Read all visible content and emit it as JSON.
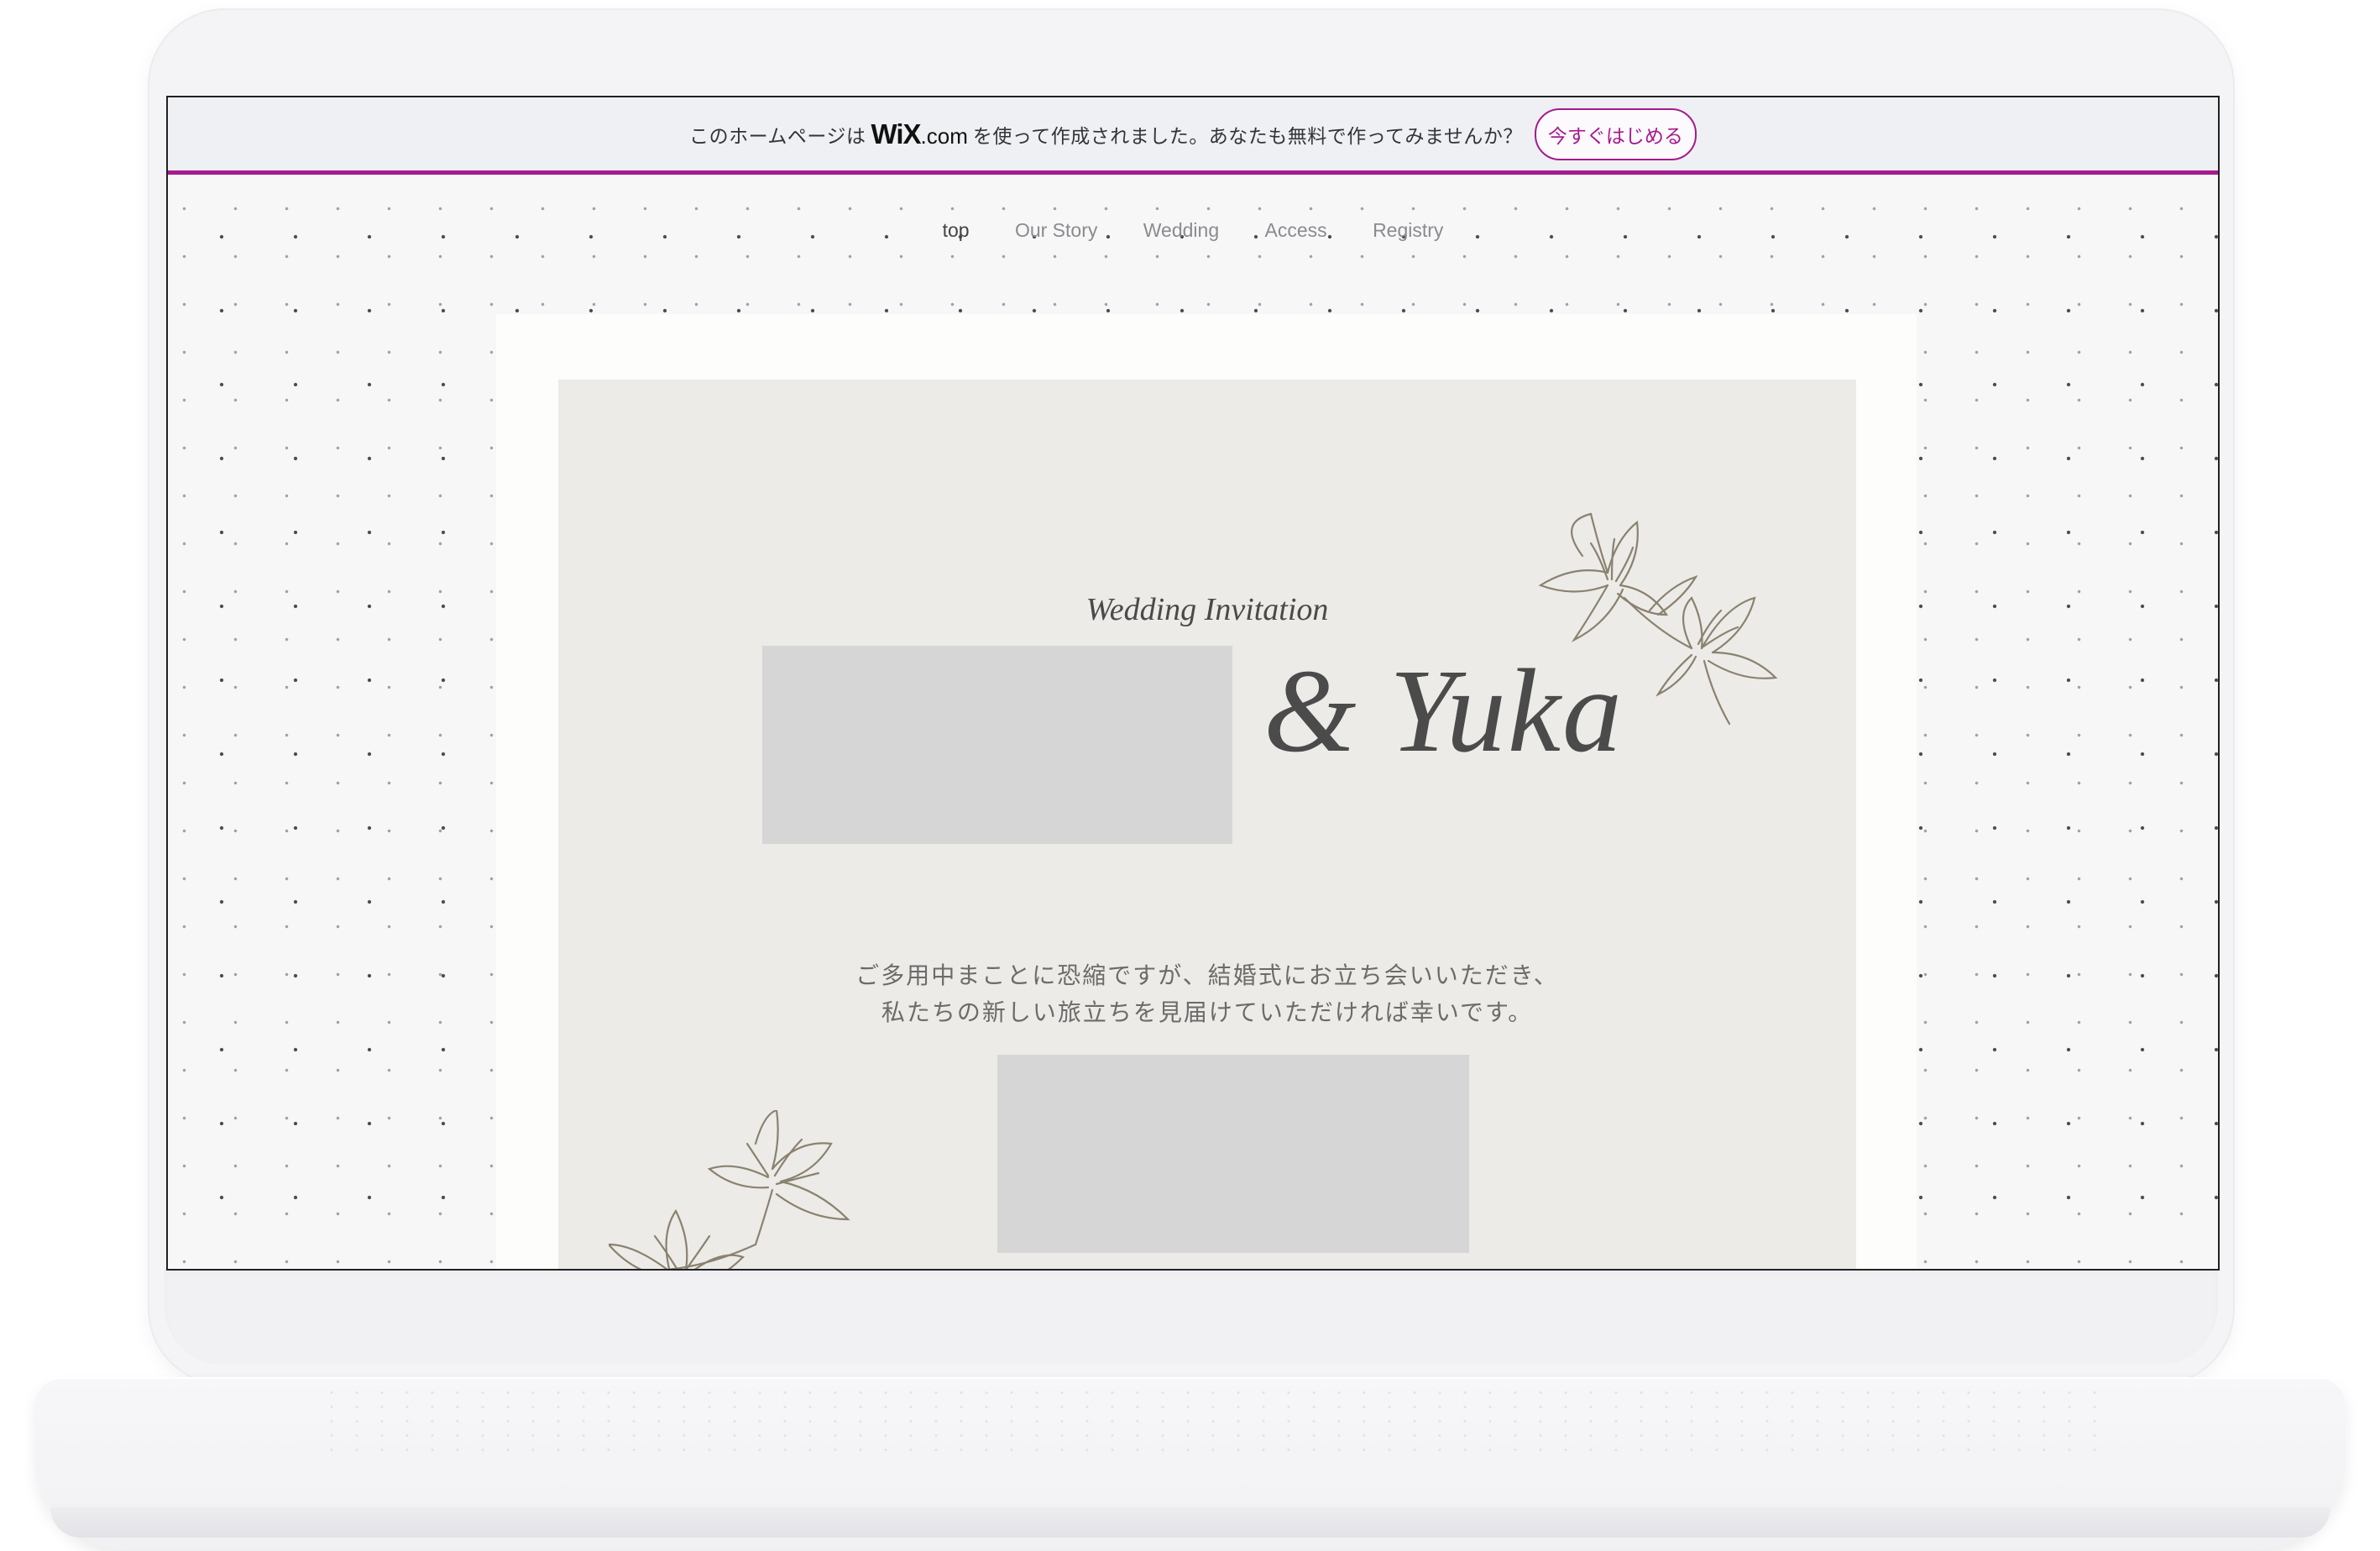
{
  "banner": {
    "text_before": "このホームページは",
    "logo_wix": "WiX",
    "logo_dotcom": ".com",
    "text_after": "を使って作成されました。あなたも無料で作ってみませんか？",
    "start_button": "今すぐはじめる",
    "accent_color": "#a51a8f"
  },
  "nav": {
    "items": [
      {
        "label": "top"
      },
      {
        "label": "Our Story"
      },
      {
        "label": "Wedding"
      },
      {
        "label": "Access"
      },
      {
        "label": "Registry"
      }
    ],
    "active": "top"
  },
  "hero": {
    "title": "Wedding Invitation",
    "names_text": "& Yuka",
    "message_line1": "ご多用中まことに恐縮ですが、結婚式にお立ち会いいただき、",
    "message_line2": "私たちの新しい旅立ちを見届けていただければ幸いです。",
    "decor_icon": "lily-flower-illustration"
  }
}
